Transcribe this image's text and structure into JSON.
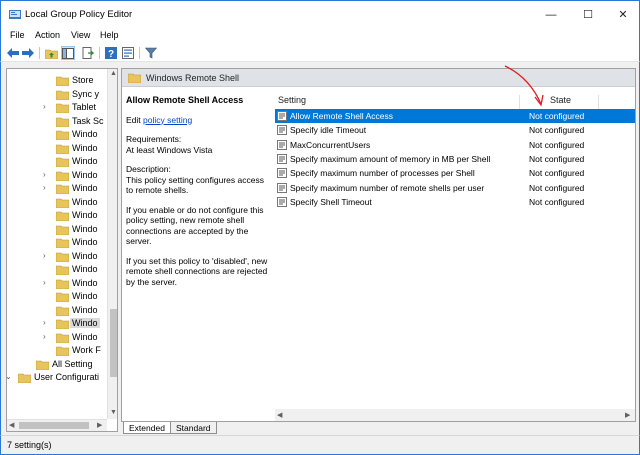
{
  "window": {
    "title": "Local Group Policy Editor",
    "minimize_glyph": "—",
    "maximize_glyph": "☐",
    "close_glyph": "✕"
  },
  "menu": [
    "File",
    "Action",
    "View",
    "Help"
  ],
  "toolbar": {
    "icons": [
      "back-arrow-icon",
      "forward-arrow-icon",
      "up-folder-icon",
      "show-hide-tree-icon",
      "export-list-icon",
      "help-icon",
      "properties-icon",
      "filter-icon"
    ]
  },
  "tree": {
    "items": [
      {
        "label": "Store",
        "expandable": false
      },
      {
        "label": "Sync y",
        "expandable": false
      },
      {
        "label": "Tablet",
        "expandable": true
      },
      {
        "label": "Task Sc",
        "expandable": false
      },
      {
        "label": "Windo",
        "expandable": false
      },
      {
        "label": "Windo",
        "expandable": false
      },
      {
        "label": "Windo",
        "expandable": false
      },
      {
        "label": "Windo",
        "expandable": true
      },
      {
        "label": "Windo",
        "expandable": true
      },
      {
        "label": "Windo",
        "expandable": false
      },
      {
        "label": "Windo",
        "expandable": false
      },
      {
        "label": "Windo",
        "expandable": false
      },
      {
        "label": "Windo",
        "expandable": false
      },
      {
        "label": "Windo",
        "expandable": true
      },
      {
        "label": "Windo",
        "expandable": false
      },
      {
        "label": "Windo",
        "expandable": true
      },
      {
        "label": "Windo",
        "expandable": false
      },
      {
        "label": "Windo",
        "expandable": false
      },
      {
        "label": "Windo",
        "expandable": true,
        "selected": true
      },
      {
        "label": "Windo",
        "expandable": true
      },
      {
        "label": "Work F",
        "expandable": false
      },
      {
        "label": "All Setting",
        "expandable": false
      },
      {
        "label": "User Configurati",
        "expandable": true
      }
    ]
  },
  "content": {
    "folder_title": "Windows Remote Shell",
    "policy_title": "Allow Remote Shell Access",
    "edit_prefix": "Edit",
    "edit_link": "policy setting",
    "requirements_label": "Requirements:",
    "requirements_value": "At least Windows Vista",
    "description_label": "Description:",
    "description_text": "This policy setting configures access to remote shells.",
    "paragraph_enable": "If you enable or do not configure this policy setting, new remote shell connections are accepted by the server.",
    "paragraph_disable": "If you set this policy to 'disabled', new remote shell connections are rejected by the server."
  },
  "list": {
    "col_setting": "Setting",
    "col_state": "State",
    "rows": [
      {
        "name": "Allow Remote Shell Access",
        "state": "Not configured",
        "selected": true
      },
      {
        "name": "Specify idle Timeout",
        "state": "Not configured"
      },
      {
        "name": "MaxConcurrentUsers",
        "state": "Not configured"
      },
      {
        "name": "Specify maximum amount of memory in MB per Shell",
        "state": "Not configured"
      },
      {
        "name": "Specify maximum number of processes per Shell",
        "state": "Not configured"
      },
      {
        "name": "Specify maximum number of remote shells per user",
        "state": "Not configured"
      },
      {
        "name": "Specify Shell Timeout",
        "state": "Not configured"
      }
    ]
  },
  "tabs": {
    "extended": "Extended",
    "standard": "Standard"
  },
  "status": {
    "text": "7 setting(s)"
  },
  "colors": {
    "selection": "#0078d7",
    "annotation": "#e02020",
    "folder": "#e8c55c"
  }
}
